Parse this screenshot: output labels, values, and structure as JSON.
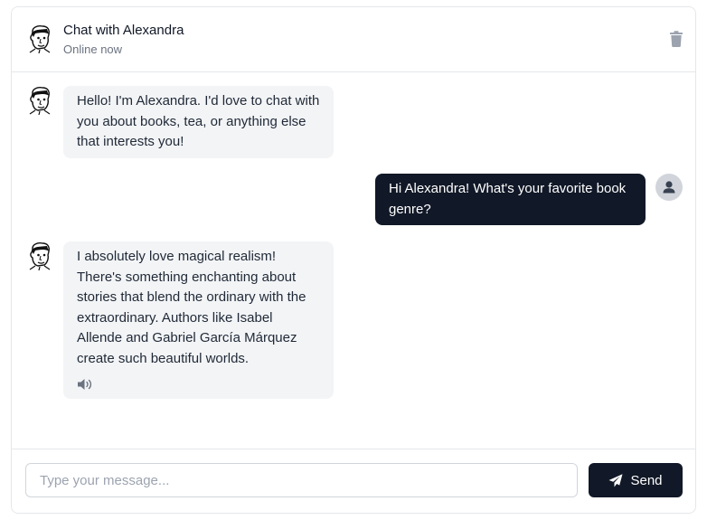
{
  "header": {
    "title": "Chat with Alexandra",
    "status": "Online now",
    "avatar_icon": "face-sketch-icon",
    "delete_icon": "trash-icon"
  },
  "messages": [
    {
      "sender": "bot",
      "text": "Hello! I'm Alexandra. I'd love to chat with you about books, tea, or anything else that interests you!"
    },
    {
      "sender": "user",
      "text": "Hi Alexandra! What's your favorite book genre?"
    },
    {
      "sender": "bot",
      "text": "I absolutely love magical realism! There's something enchanting about stories that blend the ordinary with the extraordinary. Authors like Isabel Allende and Gabriel García Márquez create such beautiful worlds.",
      "has_audio": true
    }
  ],
  "composer": {
    "placeholder": "Type your message...",
    "send_label": "Send",
    "send_icon": "paper-plane-icon"
  },
  "colors": {
    "user_bubble": "#111827",
    "bot_bubble": "#f3f4f6",
    "send_button": "#111827",
    "muted_text": "#6b7280"
  }
}
